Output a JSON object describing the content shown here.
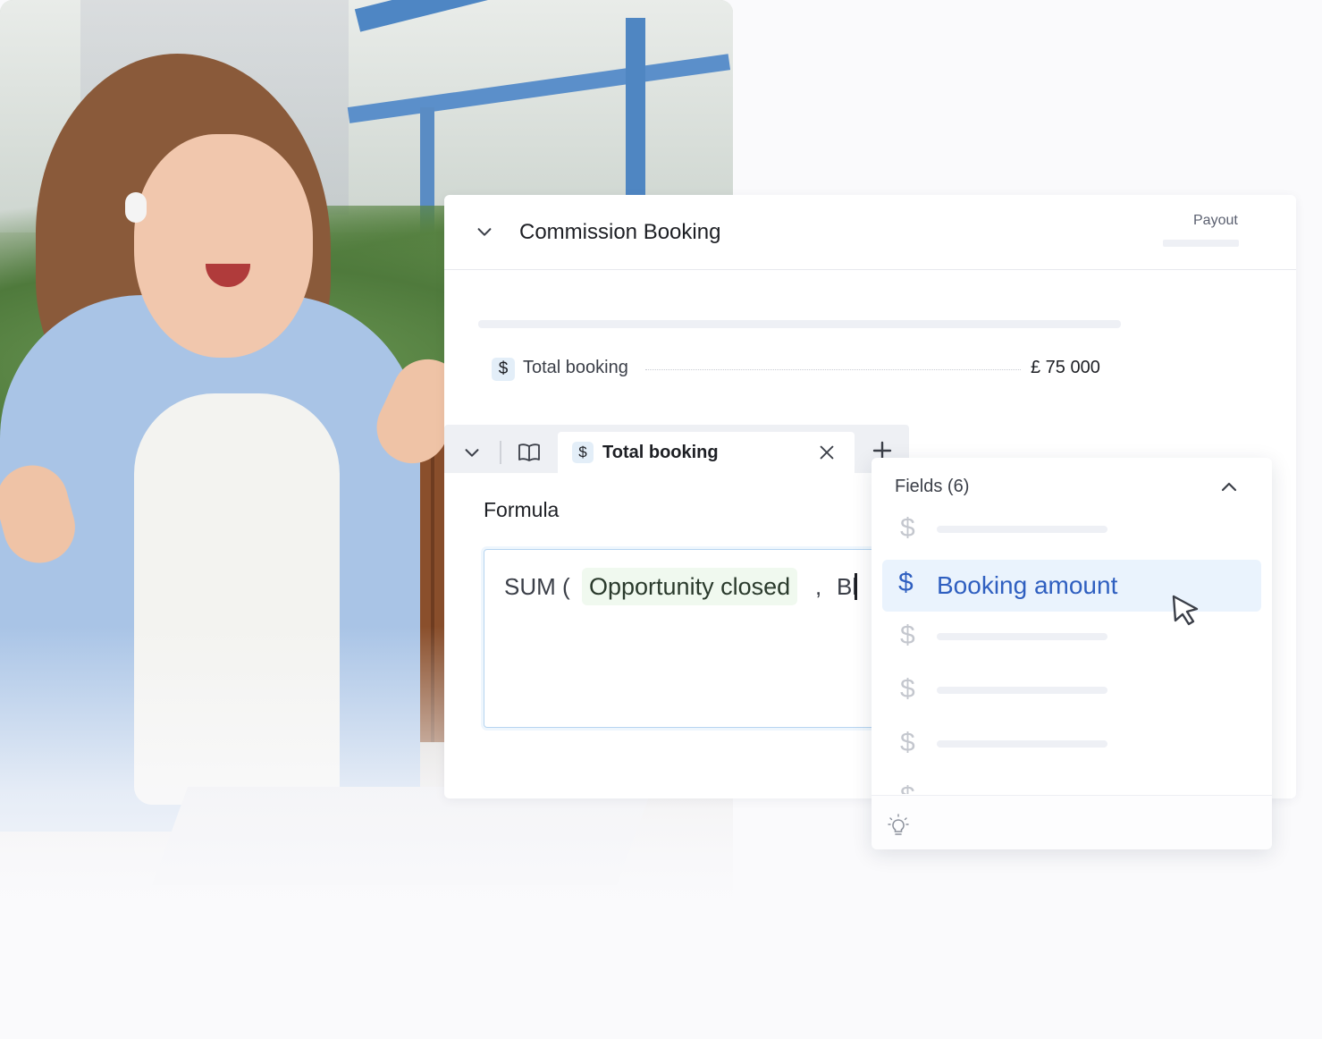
{
  "header": {
    "title": "Commission Booking",
    "tab_label": "Payout"
  },
  "summary_row": {
    "icon": "dollar-icon",
    "label": "Total booking",
    "value": "£ 75 000"
  },
  "tabbar": {
    "active_tab_label": "Total booking"
  },
  "formula": {
    "label": "Formula",
    "function": "SUM (",
    "chip": "Opportunity closed",
    "separator": ",",
    "typed": "Bl"
  },
  "fields_dropdown": {
    "title": "Fields (6)",
    "selected_field": "Booking amount",
    "item_icon": "dollar-icon"
  },
  "colors": {
    "accent": "#2f5fc0",
    "selected_bg": "#eaf3fd",
    "chip_bg": "#f0f9ef",
    "badge_bg": "#e3eef8"
  }
}
